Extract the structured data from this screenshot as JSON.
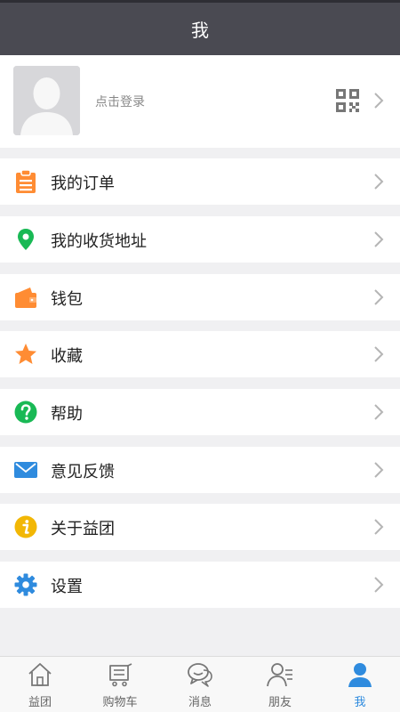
{
  "header": {
    "title": "我"
  },
  "profile": {
    "login_label": "点击登录"
  },
  "menu": [
    {
      "label": "我的订单",
      "icon": "clipboard-icon",
      "color": "#ff8c33"
    },
    {
      "label": "我的收货地址",
      "icon": "location-pin-icon",
      "color": "#19b955"
    },
    {
      "label": "钱包",
      "icon": "wallet-icon",
      "color": "#ff8c33"
    },
    {
      "label": "收藏",
      "icon": "star-icon",
      "color": "#ff8c33"
    },
    {
      "label": "帮助",
      "icon": "help-icon",
      "color": "#19b955"
    },
    {
      "label": "意见反馈",
      "icon": "mail-icon",
      "color": "#2f8bde"
    },
    {
      "label": "关于益团",
      "icon": "info-icon",
      "color": "#f2b705"
    },
    {
      "label": "设置",
      "icon": "gear-icon",
      "color": "#2f8bde"
    }
  ],
  "tabbar": {
    "active": "我",
    "tabs": [
      {
        "label": "益团",
        "icon": "home-icon"
      },
      {
        "label": "购物车",
        "icon": "cart-icon"
      },
      {
        "label": "消息",
        "icon": "chat-icon"
      },
      {
        "label": "朋友",
        "icon": "friends-icon"
      },
      {
        "label": "我",
        "icon": "person-icon"
      }
    ]
  }
}
